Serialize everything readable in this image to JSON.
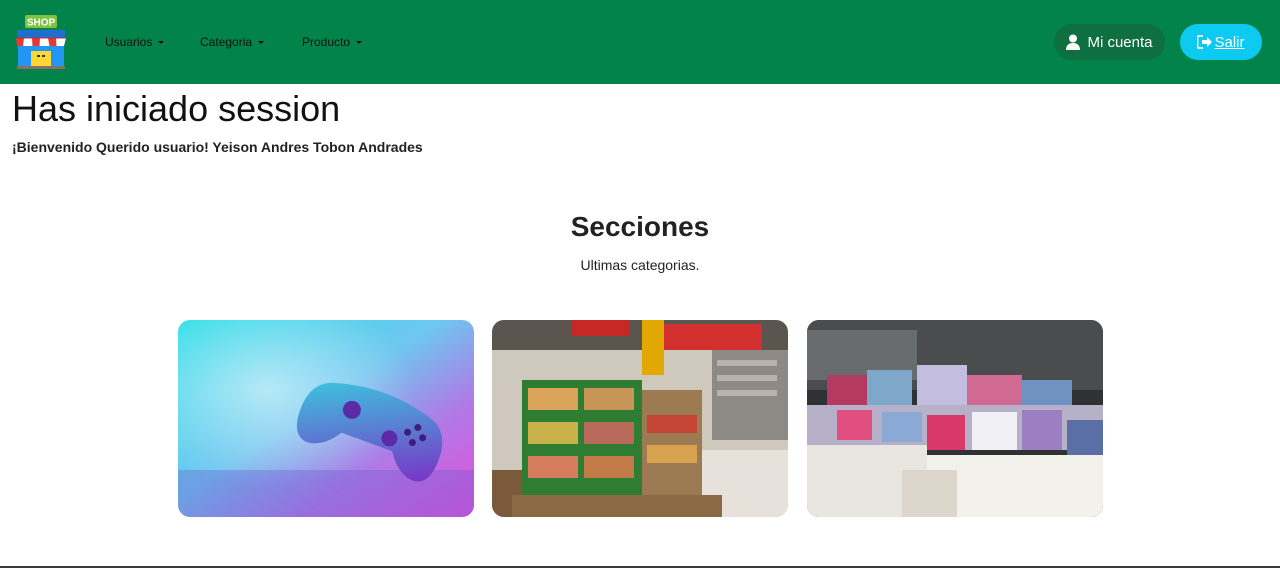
{
  "header": {
    "brand_text": "SHOP",
    "menu": [
      {
        "label": "Usuarios"
      },
      {
        "label": "Categoria"
      },
      {
        "label": "Producto"
      }
    ],
    "account_label": "Mi cuenta",
    "exit_label": "Salir",
    "colors": {
      "navbar": "#02834a",
      "account_bg": "#0e6f40",
      "exit_bg": "#0dcaf0"
    }
  },
  "main": {
    "title": "Has iniciado session",
    "welcome": "¡Bienvenido Querido usuario! Yeison Andres Tobon Andrades",
    "sections_title": "Secciones",
    "sections_subtitle": "Ultimas categorias."
  },
  "cards": [
    {
      "image": "game-controller-photo"
    },
    {
      "image": "supermarket-produce-photo"
    },
    {
      "image": "store-shelf-products-photo"
    }
  ],
  "icons": [
    "shop-logo-icon",
    "user-icon",
    "sign-out-icon",
    "caret-down-icon"
  ]
}
